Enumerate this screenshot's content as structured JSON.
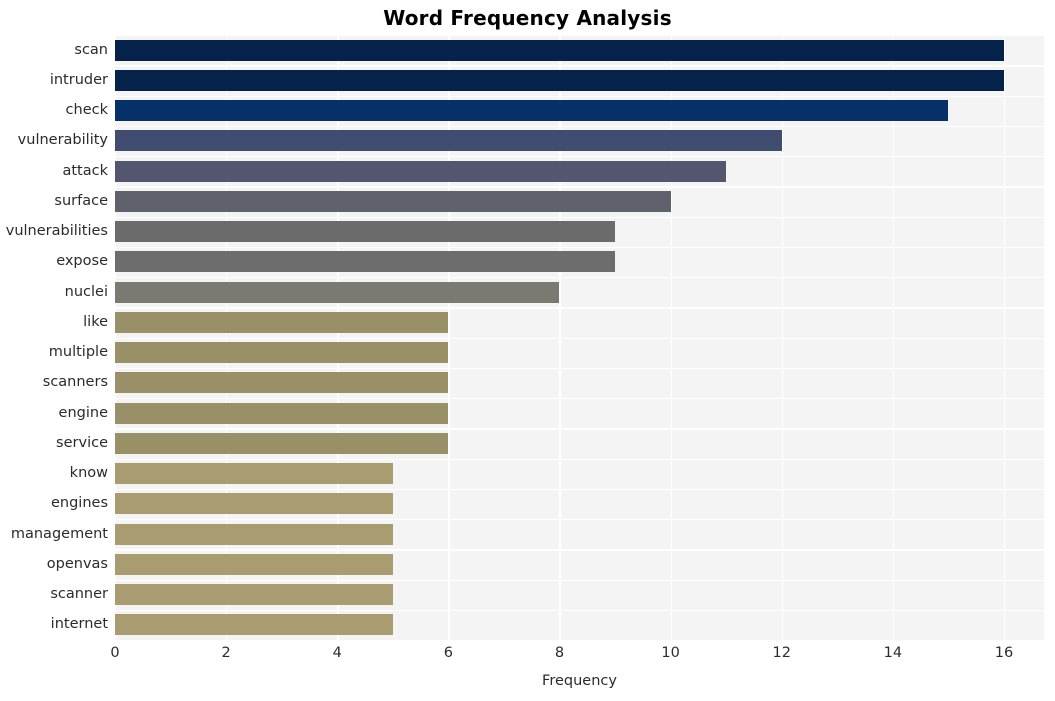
{
  "chart_data": {
    "type": "bar",
    "orientation": "horizontal",
    "title": "Word Frequency Analysis",
    "xlabel": "Frequency",
    "ylabel": "",
    "categories": [
      "scan",
      "intruder",
      "check",
      "vulnerability",
      "attack",
      "surface",
      "vulnerabilities",
      "expose",
      "nuclei",
      "like",
      "multiple",
      "scanners",
      "engine",
      "service",
      "know",
      "engines",
      "management",
      "openvas",
      "scanner",
      "internet"
    ],
    "values": [
      16,
      16,
      15,
      12,
      11,
      10,
      9,
      9,
      8,
      6,
      6,
      6,
      6,
      6,
      5,
      5,
      5,
      5,
      5,
      5
    ],
    "bar_colors": [
      "#05224b",
      "#05224b",
      "#053068",
      "#404d70",
      "#53566e",
      "#5f626c",
      "#6b6b6b",
      "#6d6d6d",
      "#7b7a72",
      "#9a9068",
      "#9a9068",
      "#9a9068",
      "#9a9068",
      "#9a9068",
      "#a89c70",
      "#a89c70",
      "#a89c70",
      "#a89c70",
      "#a89c70",
      "#a89c70"
    ],
    "xlim": [
      0,
      16.72
    ],
    "xticks": [
      0,
      2,
      4,
      6,
      8,
      10,
      12,
      14,
      16
    ],
    "xtick_labels": [
      "0",
      "2",
      "4",
      "6",
      "8",
      "10",
      "12",
      "14",
      "16"
    ],
    "grid": true,
    "grid_color": "#ffffff",
    "plot_background": "#f4f4f4",
    "figure_background": "#ffffff",
    "legend": null
  }
}
